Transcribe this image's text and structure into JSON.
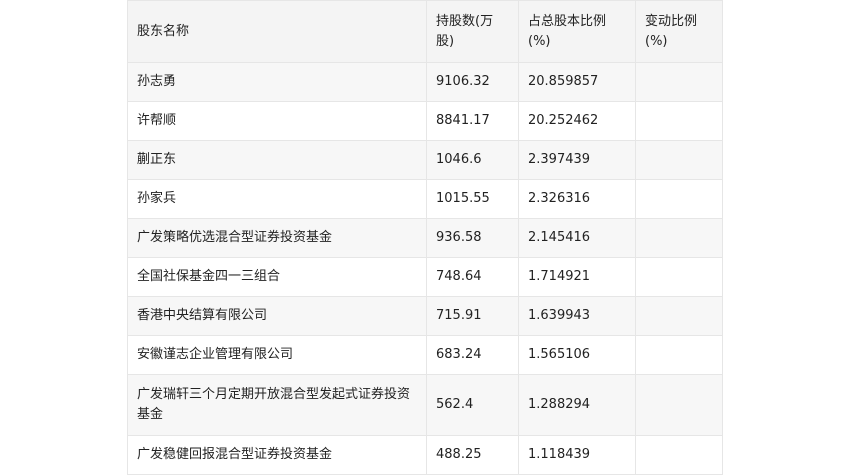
{
  "header": {
    "col_name": "股东名称",
    "col_shares": "持股数(万股)",
    "col_ratio": "占总股本比例(%)",
    "col_change": "变动比例(%)"
  },
  "rows": [
    {
      "name": "孙志勇",
      "shares": "9106.32",
      "ratio": "20.859857",
      "change": ""
    },
    {
      "name": "许帮顺",
      "shares": "8841.17",
      "ratio": "20.252462",
      "change": ""
    },
    {
      "name": "蒯正东",
      "shares": "1046.6",
      "ratio": "2.397439",
      "change": ""
    },
    {
      "name": "孙家兵",
      "shares": "1015.55",
      "ratio": "2.326316",
      "change": ""
    },
    {
      "name": "广发策略优选混合型证券投资基金",
      "shares": "936.58",
      "ratio": "2.145416",
      "change": ""
    },
    {
      "name": "全国社保基金四一三组合",
      "shares": "748.64",
      "ratio": "1.714921",
      "change": ""
    },
    {
      "name": "香港中央结算有限公司",
      "shares": "715.91",
      "ratio": "1.639943",
      "change": ""
    },
    {
      "name": "安徽谨志企业管理有限公司",
      "shares": "683.24",
      "ratio": "1.565106",
      "change": ""
    },
    {
      "name": "广发瑞轩三个月定期开放混合型发起式证券投资基金",
      "shares": "562.4",
      "ratio": "1.288294",
      "change": ""
    },
    {
      "name": "广发稳健回报混合型证券投资基金",
      "shares": "488.25",
      "ratio": "1.118439",
      "change": ""
    }
  ]
}
